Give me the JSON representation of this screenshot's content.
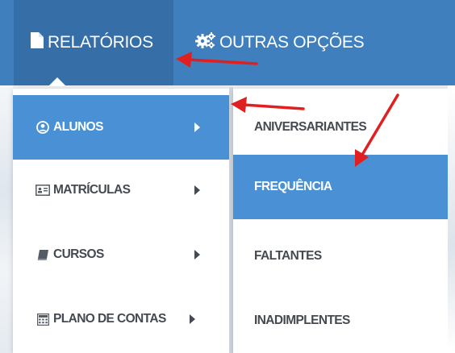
{
  "navbar": {
    "items": [
      {
        "label": "RELATÓRIOS",
        "icon": "document-icon"
      },
      {
        "label": "OUTRAS OPÇÕES",
        "icon": "gears-icon"
      }
    ]
  },
  "menu_primary": {
    "items": [
      {
        "label": "ALUNOS",
        "icon": "user-circle-icon",
        "active": true
      },
      {
        "label": "MATRÍCULAS",
        "icon": "id-card-icon",
        "active": false
      },
      {
        "label": "CURSOS",
        "icon": "book-icon",
        "active": false
      },
      {
        "label": "PLANO DE CONTAS",
        "icon": "calculator-icon",
        "active": false
      }
    ]
  },
  "menu_secondary": {
    "items": [
      {
        "label": "ANIVERSARIANTES",
        "active": false
      },
      {
        "label": "FREQUÊNCIA",
        "active": true
      },
      {
        "label": "FALTANTES",
        "active": false
      },
      {
        "label": "INADIMPLENTES",
        "active": false
      }
    ]
  },
  "colors": {
    "navbar": "#3f7fbd",
    "navbar_active": "#366ea8",
    "menu_active": "#4a90d4",
    "annotation_arrow": "#e02020"
  }
}
